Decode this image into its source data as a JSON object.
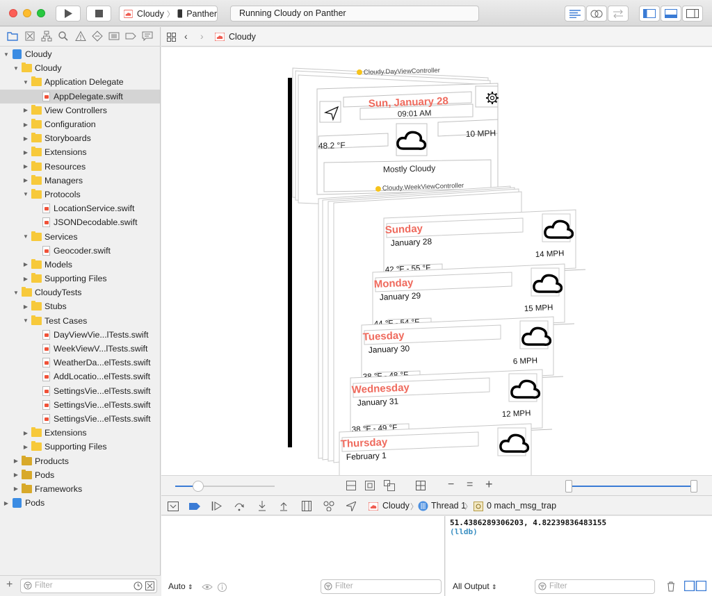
{
  "toolbar": {
    "scheme_app": "Cloudy",
    "scheme_device": "Panther",
    "status": "Running Cloudy on Panther"
  },
  "navigator": {
    "items": [
      {
        "label": "Cloudy",
        "level": 0,
        "type": "project",
        "expanded": true
      },
      {
        "label": "Cloudy",
        "level": 1,
        "type": "folder",
        "expanded": true
      },
      {
        "label": "Application Delegate",
        "level": 2,
        "type": "folder",
        "expanded": true
      },
      {
        "label": "AppDelegate.swift",
        "level": 3,
        "type": "swift",
        "selected": true
      },
      {
        "label": "View Controllers",
        "level": 2,
        "type": "folder",
        "expanded": false
      },
      {
        "label": "Configuration",
        "level": 2,
        "type": "folder",
        "expanded": false
      },
      {
        "label": "Storyboards",
        "level": 2,
        "type": "folder",
        "expanded": false
      },
      {
        "label": "Extensions",
        "level": 2,
        "type": "folder",
        "expanded": false
      },
      {
        "label": "Resources",
        "level": 2,
        "type": "folder",
        "expanded": false
      },
      {
        "label": "Managers",
        "level": 2,
        "type": "folder",
        "expanded": false
      },
      {
        "label": "Protocols",
        "level": 2,
        "type": "folder",
        "expanded": true
      },
      {
        "label": "LocationService.swift",
        "level": 3,
        "type": "swift"
      },
      {
        "label": "JSONDecodable.swift",
        "level": 3,
        "type": "swift"
      },
      {
        "label": "Services",
        "level": 2,
        "type": "folder",
        "expanded": true
      },
      {
        "label": "Geocoder.swift",
        "level": 3,
        "type": "swift"
      },
      {
        "label": "Models",
        "level": 2,
        "type": "folder",
        "expanded": false
      },
      {
        "label": "Supporting Files",
        "level": 2,
        "type": "folder",
        "expanded": false
      },
      {
        "label": "CloudyTests",
        "level": 1,
        "type": "folder",
        "expanded": true
      },
      {
        "label": "Stubs",
        "level": 2,
        "type": "folder",
        "expanded": false
      },
      {
        "label": "Test Cases",
        "level": 2,
        "type": "folder",
        "expanded": true
      },
      {
        "label": "DayViewVie...lTests.swift",
        "level": 3,
        "type": "swift"
      },
      {
        "label": "WeekViewV...lTests.swift",
        "level": 3,
        "type": "swift"
      },
      {
        "label": "WeatherDa...elTests.swift",
        "level": 3,
        "type": "swift"
      },
      {
        "label": "AddLocatio...elTests.swift",
        "level": 3,
        "type": "swift"
      },
      {
        "label": "SettingsVie...elTests.swift",
        "level": 3,
        "type": "swift"
      },
      {
        "label": "SettingsVie...elTests.swift",
        "level": 3,
        "type": "swift"
      },
      {
        "label": "SettingsVie...elTests.swift",
        "level": 3,
        "type": "swift"
      },
      {
        "label": "Extensions",
        "level": 2,
        "type": "folder",
        "expanded": false
      },
      {
        "label": "Supporting Files",
        "level": 2,
        "type": "folder",
        "expanded": false
      },
      {
        "label": "Products",
        "level": 1,
        "type": "folder-dark",
        "expanded": false
      },
      {
        "label": "Pods",
        "level": 1,
        "type": "folder-dark",
        "expanded": false
      },
      {
        "label": "Frameworks",
        "level": 1,
        "type": "folder-dark",
        "expanded": false
      },
      {
        "label": "Pods",
        "level": 0,
        "type": "project",
        "expanded": false
      }
    ],
    "filter_placeholder": "Filter"
  },
  "jumpbar": {
    "crumb": "Cloudy"
  },
  "canvas": {
    "day_controller_label": "Cloudy.DayViewController",
    "day": {
      "date": "Sun, January 28",
      "time": "09:01 AM",
      "wind": "10 MPH",
      "temperature": "48.2 °F",
      "summary": "Mostly Cloudy"
    },
    "week_controller_label": "Cloudy.WeekViewController",
    "week": [
      {
        "day": "Sunday",
        "date": "January 28",
        "wind": "14 MPH",
        "temps": "42 °F - 55 °F"
      },
      {
        "day": "Monday",
        "date": "January 29",
        "wind": "15 MPH",
        "temps": "44 °F - 54 °F"
      },
      {
        "day": "Tuesday",
        "date": "January 30",
        "wind": "6 MPH",
        "temps": "38 °F - 48 °F"
      },
      {
        "day": "Wednesday",
        "date": "January 31",
        "wind": "12 MPH",
        "temps": "38 °F - 49 °F"
      },
      {
        "day": "Thursday",
        "date": "February 1",
        "wind": "",
        "temps": ""
      }
    ]
  },
  "debugbar": {
    "app": "Cloudy",
    "thread": "Thread 1",
    "frame": "0 mach_msg_trap"
  },
  "variables": {
    "scope": "Auto",
    "filter_placeholder": "Filter"
  },
  "console": {
    "line1": "51.4386289306203, 4.82239836483155",
    "prompt": "(lldb)",
    "output_mode": "All Output",
    "filter_placeholder": "Filter"
  }
}
